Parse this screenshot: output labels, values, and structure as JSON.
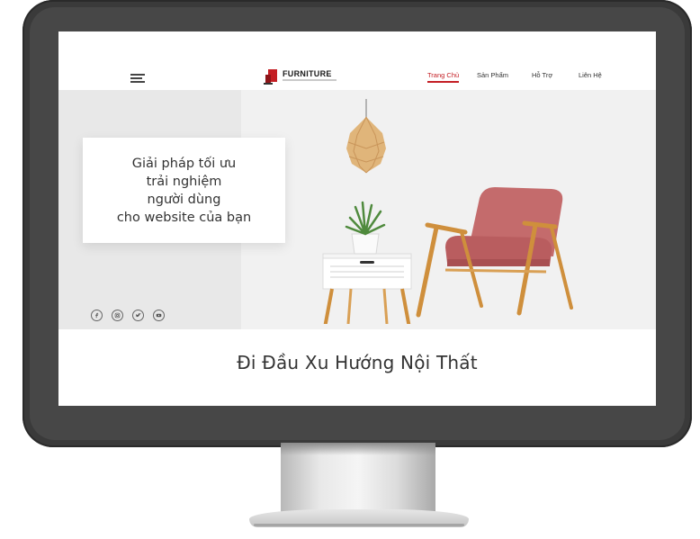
{
  "header": {
    "menu_icon": "hamburger-menu-icon",
    "logo_text": "FURNITURE",
    "nav": [
      {
        "label": "Trang Chủ",
        "active": true
      },
      {
        "label": "Sản Phẩm",
        "active": false
      },
      {
        "label": "Hỗ Trợ",
        "active": false
      },
      {
        "label": "Liên Hệ",
        "active": false
      }
    ]
  },
  "hero": {
    "card_text": "Giải pháp tối ưu\ntrải nghiệm\nngười dùng\ncho website của bạn",
    "socials": [
      "facebook-icon",
      "instagram-icon",
      "twitter-icon",
      "youtube-icon"
    ]
  },
  "tagline": "Đi Đầu Xu Hướng Nội Thất",
  "colors": {
    "accent": "#c41e24",
    "monitor_bezel": "#3a3a3a",
    "hero_background": "#f1f1f1"
  }
}
